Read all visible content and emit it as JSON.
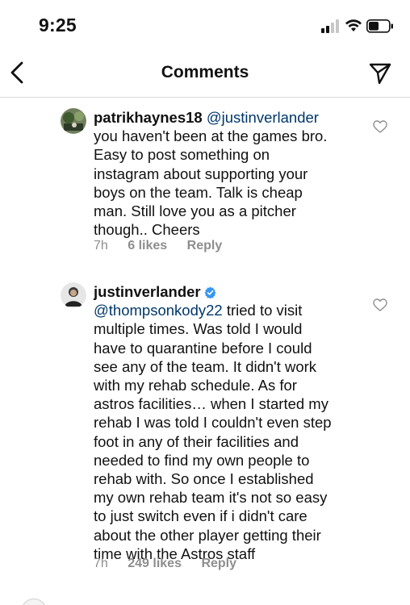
{
  "status_bar": {
    "time": "9:25"
  },
  "header": {
    "title": "Comments",
    "back_icon": "chevron-left-icon",
    "share_icon": "paper-plane-icon"
  },
  "comments": [
    {
      "username": "patrikhaynes18",
      "mention": "@justinverlander",
      "text_lines": [
        "you haven't been at the games bro.",
        "Easy to post something on",
        "instagram about supporting your",
        "boys on the team. Talk is cheap",
        "man.  Still love you as a pitcher",
        "though.. Cheers"
      ],
      "time": "7h",
      "likes": "6 likes",
      "reply_label": "Reply",
      "verified": false
    },
    {
      "username": "justinverlander",
      "verified": true,
      "mention": "@thompsonkody22",
      "first_line_rest": " tried to visit",
      "text_lines": [
        "multiple times.  Was told I would",
        "have to quarantine before I could",
        "see any of the team.  It didn't work",
        "with my rehab schedule. As for",
        "astros facilities…  when I started my",
        "rehab I was told I couldn't even step",
        "foot in any of their facilities and",
        "needed to find my own people to",
        "rehab with. So once I established",
        "my own rehab team it's not so easy",
        "to just switch even if i didn't care",
        "about the other player getting their",
        "time with the Astros staff"
      ],
      "time": "7h",
      "likes": "249 likes",
      "reply_label": "Reply"
    }
  ],
  "colors": {
    "mention": "#00376b",
    "meta": "#8e8e8e",
    "verified": "#3897f0",
    "divider": "#dbdbdb"
  }
}
